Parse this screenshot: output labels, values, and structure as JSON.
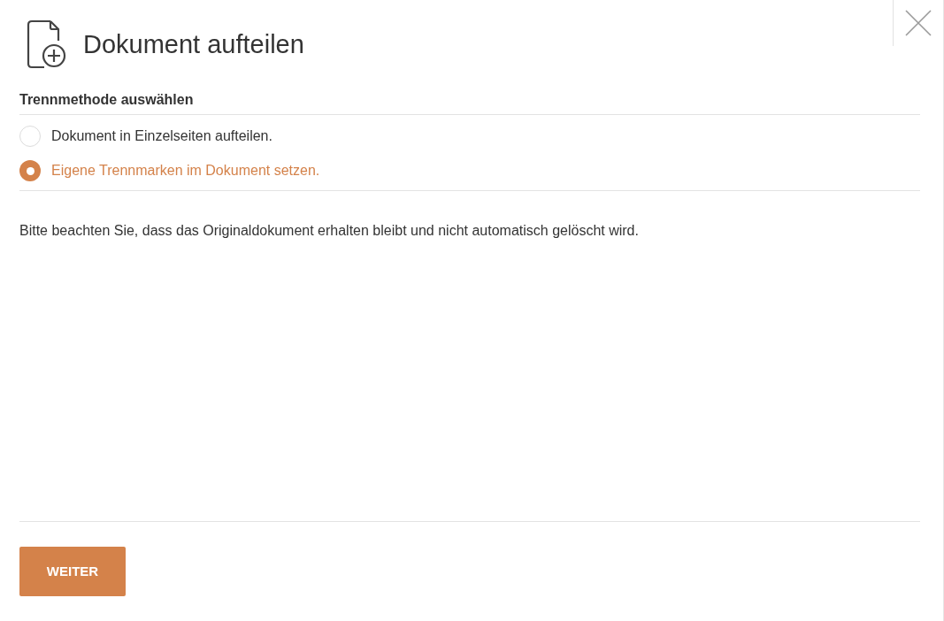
{
  "dialog": {
    "title": "Dokument aufteilen",
    "section_label": "Trennmethode auswählen",
    "options": [
      {
        "label": "Dokument in Einzelseiten aufteilen.",
        "selected": false
      },
      {
        "label": "Eigene Trennmarken im Dokument setzen.",
        "selected": true
      }
    ],
    "note": "Bitte beachten Sie, dass das Originaldokument erhalten bleibt und nicht automatisch gelöscht wird.",
    "primary_button": "WEITER"
  }
}
